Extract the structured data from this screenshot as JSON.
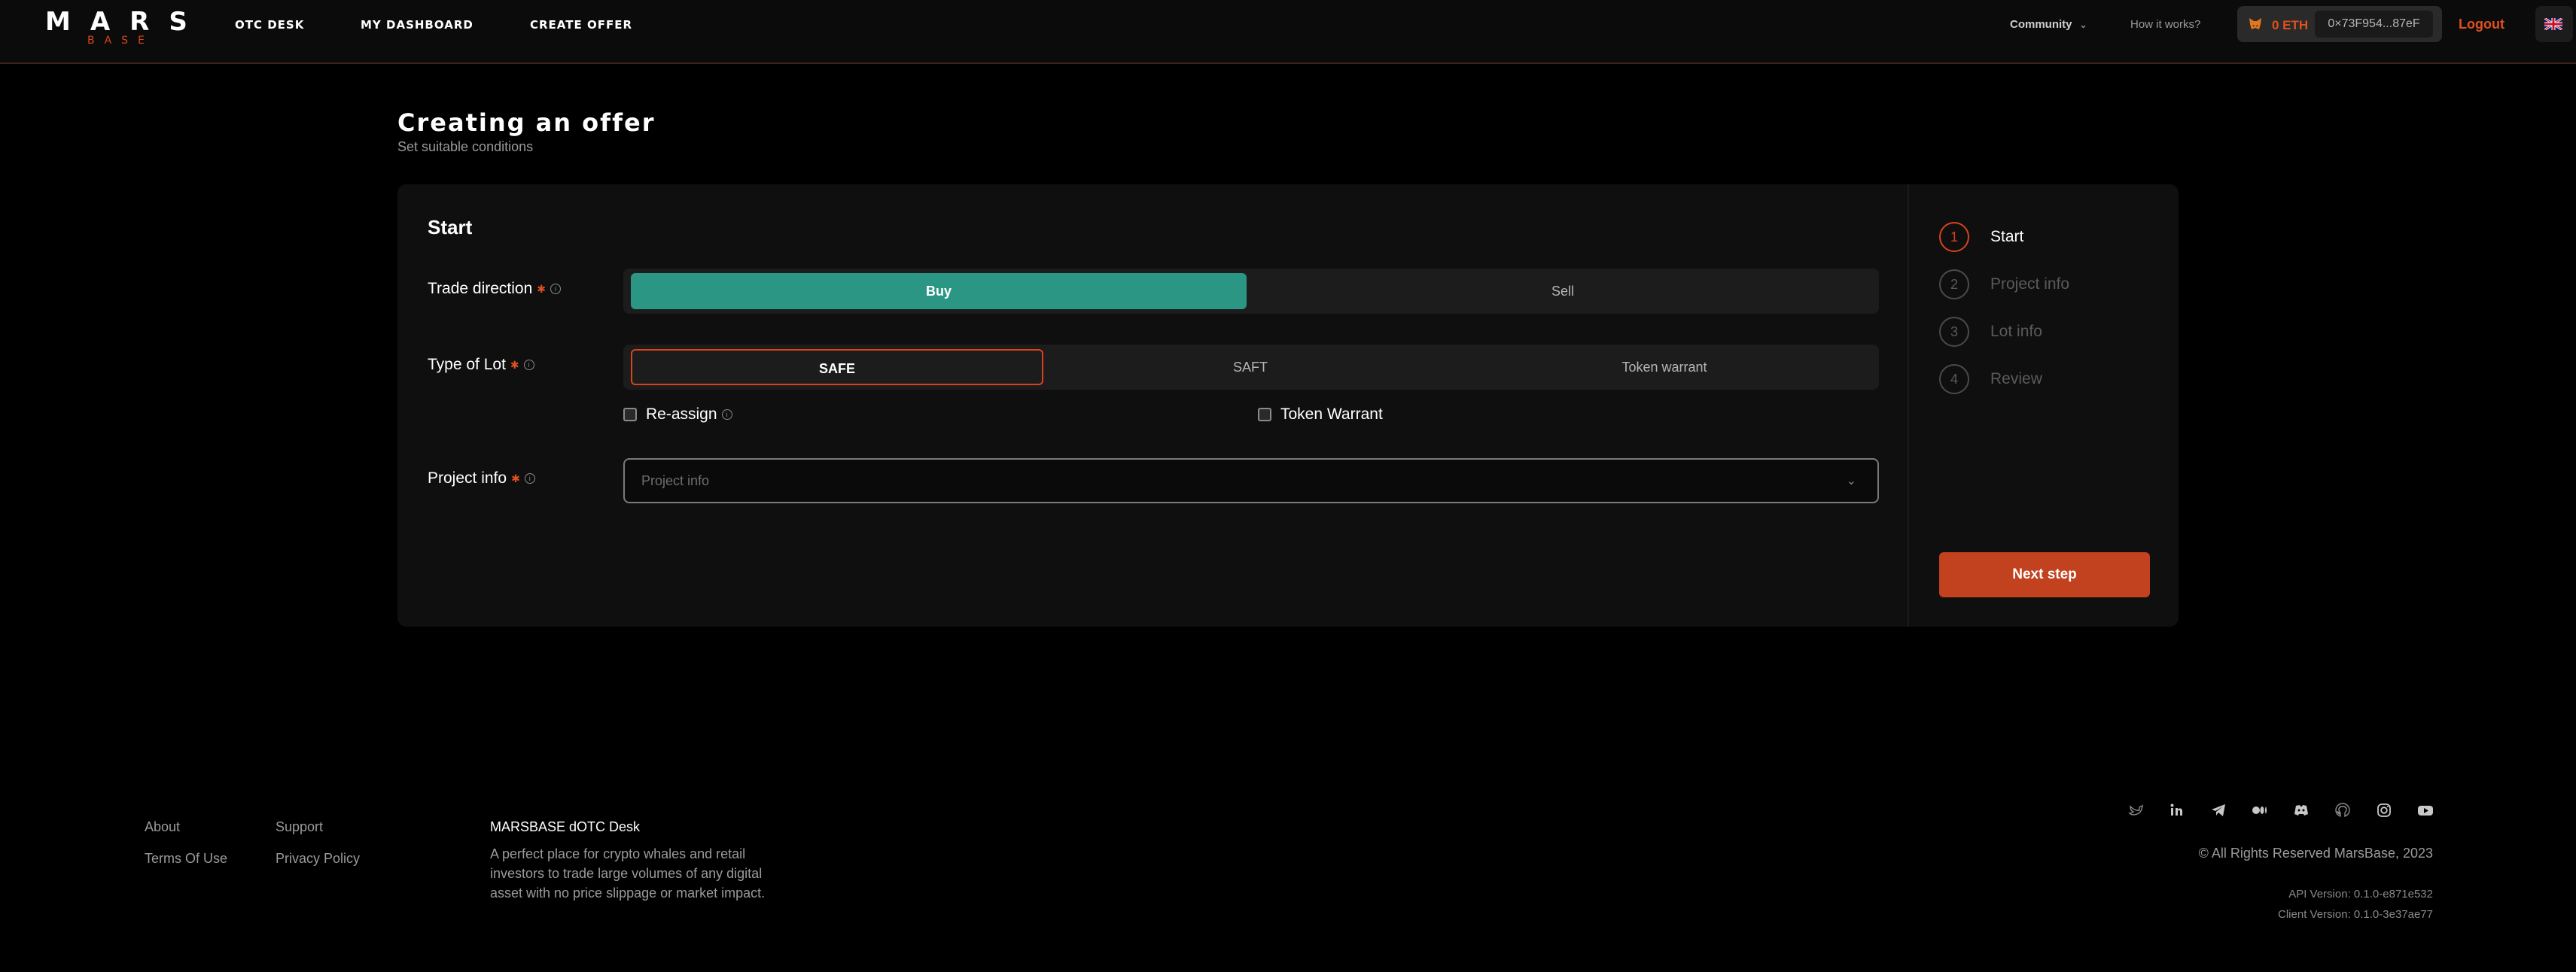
{
  "header": {
    "logo_top": "MARS",
    "logo_bottom": "BASE",
    "nav": [
      "OTC DESK",
      "MY DASHBOARD",
      "CREATE OFFER"
    ],
    "community": "Community",
    "how_it_works": "How it works?",
    "wallet_balance": "0 ETH",
    "wallet_address": "0×73F954...87eF",
    "logout": "Logout"
  },
  "page": {
    "title": "Creating an offer",
    "subtitle": "Set suitable conditions"
  },
  "form": {
    "section_title": "Start",
    "trade_direction_label": "Trade direction",
    "trade_direction_options": [
      "Buy",
      "Sell"
    ],
    "trade_direction_selected": "Buy",
    "type_of_lot_label": "Type of Lot",
    "type_of_lot_options": [
      "SAFE",
      "SAFT",
      "Token warrant"
    ],
    "type_of_lot_selected": "SAFE",
    "checkbox_reassign": "Re-assign",
    "checkbox_token_warrant": "Token Warrant",
    "project_info_label": "Project info",
    "project_info_placeholder": "Project info"
  },
  "steps": [
    {
      "num": "1",
      "label": "Start"
    },
    {
      "num": "2",
      "label": "Project info"
    },
    {
      "num": "3",
      "label": "Lot info"
    },
    {
      "num": "4",
      "label": "Review"
    }
  ],
  "next_button": "Next step",
  "footer": {
    "about": "About",
    "support": "Support",
    "terms": "Terms Of Use",
    "privacy": "Privacy Policy",
    "title": "MARSBASE dOTC Desk",
    "description": "A perfect place for crypto whales and retail investors to trade large volumes of any digital asset with no price slippage or market impact.",
    "copyright": "© All Rights Reserved MarsBase, 2023",
    "api_version": "API Version: 0.1.0-e871e532",
    "client_version": "Client Version: 0.1.0-3e37ae77",
    "socials": [
      "twitter-icon",
      "linkedin-icon",
      "telegram-icon",
      "medium-icon",
      "discord-icon",
      "github-icon",
      "instagram-icon",
      "youtube-icon"
    ]
  },
  "colors": {
    "accent": "#d9421c",
    "buy_green": "#2a9683",
    "button": "#c2411e"
  }
}
